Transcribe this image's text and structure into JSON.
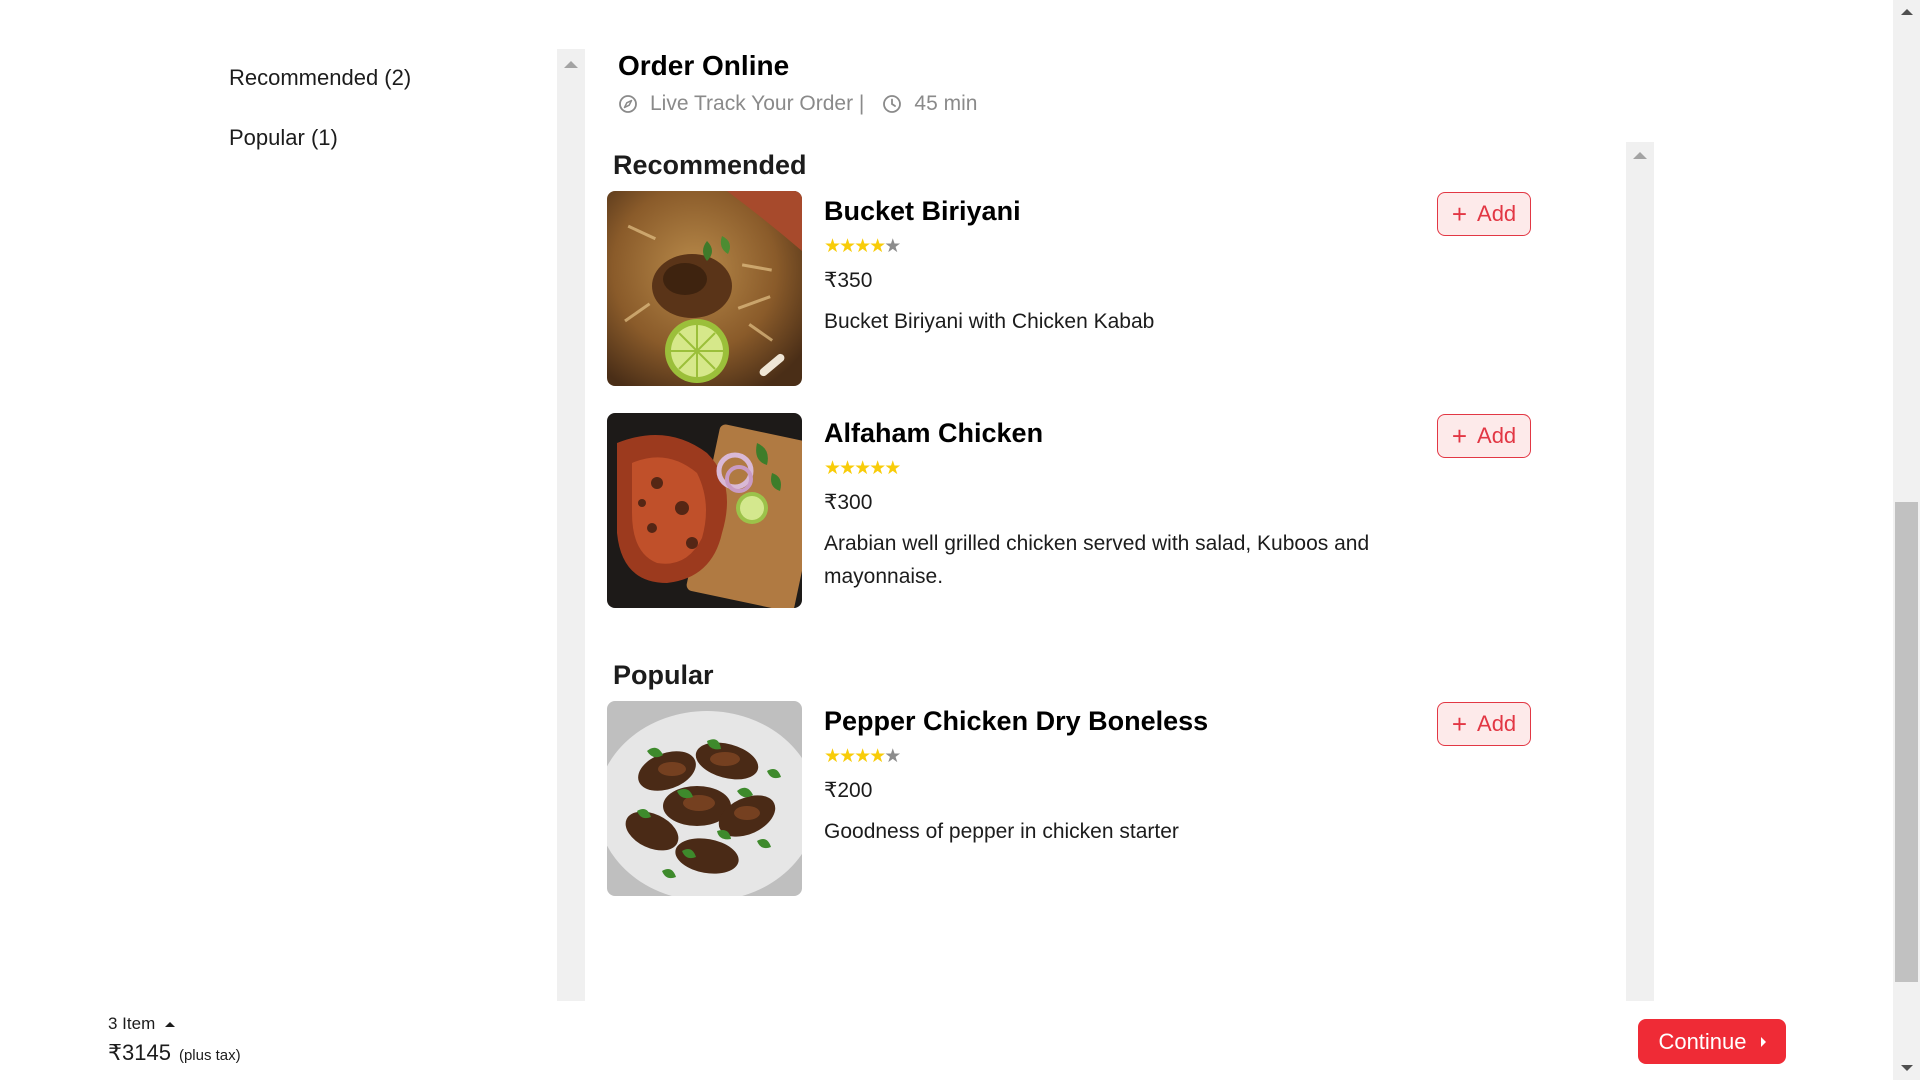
{
  "categories": [
    {
      "label": "Recommended (2)"
    },
    {
      "label": "Popular (1)"
    }
  ],
  "header": {
    "title": "Order Online",
    "track_label": "Live Track Your Order |",
    "time_label": "45 min"
  },
  "sections": [
    {
      "title": "Recommended",
      "dishes": [
        {
          "name": "Bucket Biriyani",
          "rating": 4,
          "price": "₹350",
          "description": "Bucket Biriyani with Chicken Kabab",
          "add_label": "Add",
          "image": "biryani-photo"
        },
        {
          "name": "Alfaham Chicken",
          "rating": 5,
          "price": "₹300",
          "description": "Arabian well grilled chicken served with salad, Kuboos and mayonnaise.",
          "add_label": "Add",
          "image": "grilled-chicken-photo"
        }
      ]
    },
    {
      "title": "Popular",
      "dishes": [
        {
          "name": "Pepper Chicken Dry Boneless",
          "rating": 4,
          "price": "₹200",
          "description": "Goodness of pepper in chicken starter",
          "add_label": "Add",
          "image": "pepper-chicken-photo"
        }
      ]
    }
  ],
  "cart": {
    "count_label": "3 Item",
    "total": "₹3145",
    "tax_note": "(plus tax)"
  },
  "continue_label": "Continue",
  "colors": {
    "accent": "#e23744",
    "continue_bg": "#ef2b36",
    "star_on": "#f8cc09",
    "star_off": "#8c8c8c"
  },
  "icons": {
    "track": "compass-icon",
    "time": "clock-icon",
    "add": "plus-icon",
    "cart_toggle": "caret-up-icon",
    "continue": "caret-right-icon"
  }
}
